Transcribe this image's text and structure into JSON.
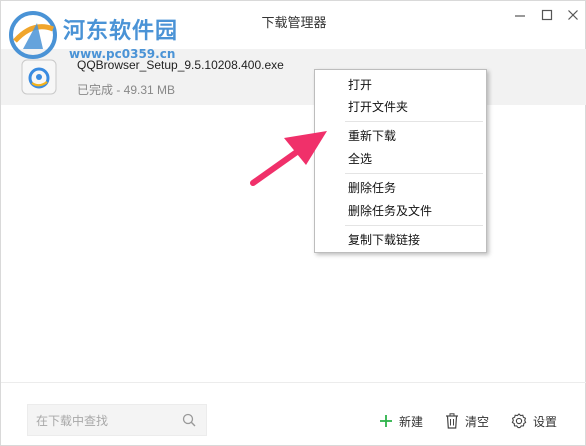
{
  "window": {
    "title": "下载管理器",
    "controls": [
      "minimize-icon",
      "maximize-icon",
      "close-icon"
    ]
  },
  "watermark": {
    "site_name": "河东软件园",
    "url": "www.pc0359.cn",
    "color": "#4a93d6"
  },
  "download": {
    "file_name": "QQBrowser_Setup_9.5.10208.400.exe",
    "status": "已完成 - 49.31 MB",
    "icon": "qqbrowser-installer-icon"
  },
  "context_menu": {
    "items": [
      {
        "label": "打开"
      },
      {
        "label": "打开文件夹"
      },
      {
        "label": "重新下载"
      },
      {
        "label": "全选"
      },
      {
        "label": "删除任务"
      },
      {
        "label": "删除任务及文件"
      },
      {
        "label": "复制下载链接"
      }
    ]
  },
  "annotation": {
    "arrow_color": "#f0306a"
  },
  "footer": {
    "search_placeholder": "在下载中查找",
    "new_label": "新建",
    "clear_label": "清空",
    "settings_label": "设置",
    "accent_color": "#2eb34a"
  }
}
